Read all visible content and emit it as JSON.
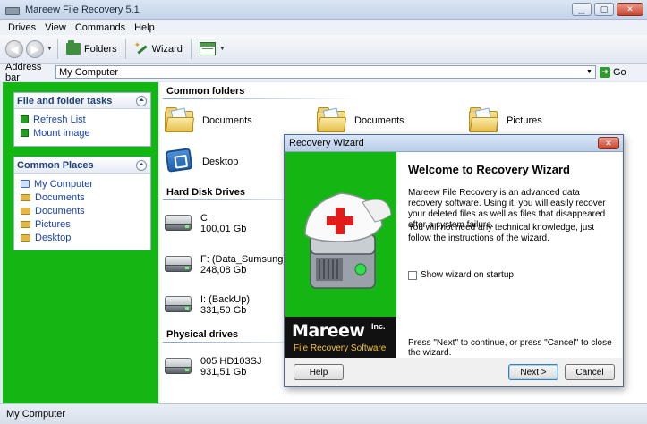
{
  "window": {
    "title": "Mareew File Recovery 5.1"
  },
  "menu": [
    "Drives",
    "View",
    "Commands",
    "Help"
  ],
  "toolbar": {
    "folders_label": "Folders",
    "wizard_label": "Wizard"
  },
  "address": {
    "label": "Address bar:",
    "value": "My Computer",
    "go_label": "Go"
  },
  "file_tasks": {
    "title": "File and folder tasks",
    "items": [
      "Refresh List",
      "Mount image"
    ]
  },
  "common_places": {
    "title": "Common Places",
    "items": [
      "My Computer",
      "Documents",
      "Documents",
      "Pictures",
      "Desktop"
    ]
  },
  "main": {
    "common_folders": {
      "title": "Common folders",
      "items": [
        "Documents",
        "Documents",
        "Pictures",
        "Desktop"
      ]
    },
    "hard_disk_drives": {
      "title": "Hard Disk Drives",
      "items": [
        {
          "name": "C:",
          "size": "100,01 Gb"
        },
        {
          "name": "F: (Data_Sumsung)",
          "size": "248,08 Gb"
        },
        {
          "name": "I: (BackUp)",
          "size": "331,50 Gb"
        }
      ]
    },
    "physical_drives": {
      "title": "Physical drives",
      "items": [
        {
          "name": "005 HD103SJ",
          "size": "931,51 Gb"
        }
      ]
    }
  },
  "status": {
    "text": "My Computer"
  },
  "dialog": {
    "title": "Recovery Wizard",
    "heading": "Welcome to Recovery Wizard",
    "paragraph1": "Mareew File Recovery is an advanced data recovery software. Using it, you will easily recover your deleted files as well as files that disappeared after a system failure.",
    "paragraph2": "You will not need any technical knowledge, just follow the instructions of the wizard.",
    "checkbox_label": "Show wizard on startup",
    "footer_text": "Press \"Next\" to continue, or press \"Cancel\" to close the wizard.",
    "logo_main": "Mareew",
    "logo_inc": "Inc.",
    "logo_sub": "File Recovery Software",
    "help_label": "Help",
    "next_label": "Next >",
    "cancel_label": "Cancel"
  },
  "colors": {
    "panel_green": "#14b614",
    "link_blue": "#1a3fa8"
  }
}
